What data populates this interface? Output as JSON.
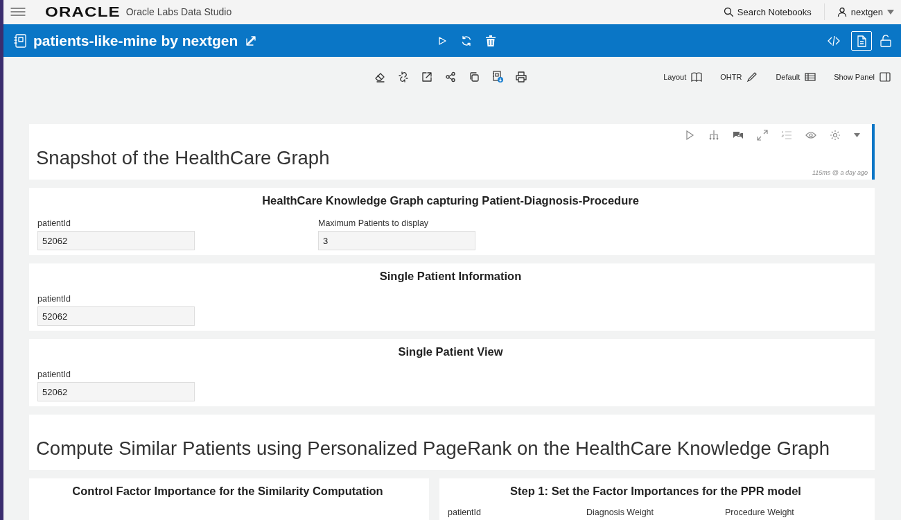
{
  "header": {
    "logo": "ORACLE",
    "product": "Oracle Labs Data Studio",
    "search": "Search Notebooks",
    "user": "nextgen"
  },
  "notebook": {
    "title": "patients-like-mine by nextgen",
    "view_modes": [
      {
        "selected": false
      },
      {
        "selected": true
      }
    ]
  },
  "toolbar": {
    "menus": [
      "Layout",
      "OHTR",
      "Default",
      "Show Panel"
    ]
  },
  "paragraphs": [
    {
      "kind": "heading",
      "title": "Snapshot of the HealthCare Graph",
      "selected": true,
      "timestamp": "115ms @ a day ago"
    },
    {
      "kind": "form",
      "title": "HealthCare Knowledge Graph capturing Patient-Diagnosis-Procedure",
      "fields": [
        {
          "label": "patientId",
          "value": "52062"
        },
        {
          "label": "Maximum Patients to display",
          "value": "3"
        }
      ]
    },
    {
      "kind": "form",
      "title": "Single Patient Information",
      "fields": [
        {
          "label": "patientId",
          "value": "52062"
        }
      ]
    },
    {
      "kind": "form",
      "title": "Single Patient View",
      "fields": [
        {
          "label": "patientId",
          "value": "52062"
        }
      ]
    },
    {
      "kind": "heading",
      "title": "Compute Similar Patients using Personalized PageRank on the HealthCare Knowledge Graph",
      "selected": false
    },
    {
      "kind": "columns",
      "panels": [
        {
          "title": "Control Factor Importance for the Similarity Computation"
        },
        {
          "title": "Step 1: Set the Factor Importances for the PPR model",
          "fields": [
            {
              "label": "patientId"
            },
            {
              "label": "Diagnosis Weight"
            },
            {
              "label": "Procedure Weight"
            }
          ]
        }
      ]
    }
  ]
}
